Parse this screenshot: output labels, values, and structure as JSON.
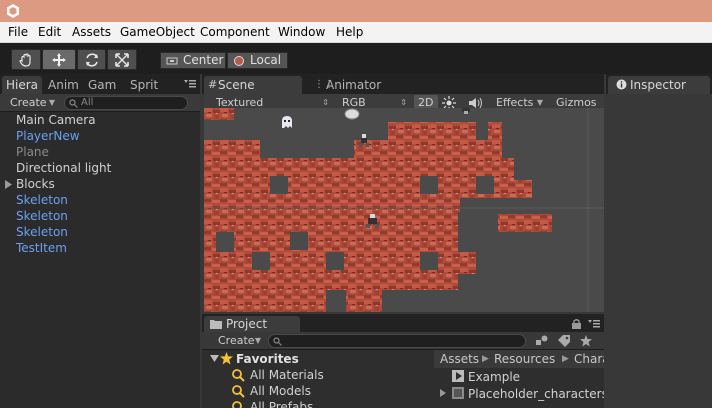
{
  "app": {
    "logo_icon": "unity-logo-icon"
  },
  "menu": {
    "items": [
      "File",
      "Edit",
      "Assets",
      "GameObject",
      "Component",
      "Window",
      "Help"
    ]
  },
  "toolbar": {
    "pivot": "Center",
    "space": "Local"
  },
  "hierarchy": {
    "tabs": [
      "Hiera",
      "Anim",
      "Gam",
      "Sprit"
    ],
    "create_label": "Create",
    "search_placeholder": "All",
    "items": [
      {
        "label": "Main Camera",
        "style": "normal"
      },
      {
        "label": "PlayerNew",
        "style": "blue"
      },
      {
        "label": "Plane",
        "style": "gray"
      },
      {
        "label": "Directional light",
        "style": "normal"
      },
      {
        "label": "Blocks",
        "style": "normal",
        "expandable": true
      },
      {
        "label": "Skeleton",
        "style": "blue"
      },
      {
        "label": "Skeleton",
        "style": "blue"
      },
      {
        "label": "Skeleton",
        "style": "blue"
      },
      {
        "label": "TestItem",
        "style": "blue"
      }
    ]
  },
  "scene": {
    "tabs": [
      "Scene",
      "Animator"
    ],
    "toolbar": {
      "render_mode": "Textured",
      "channel": "RGB",
      "mode_2d": "2D",
      "effects": "Effects",
      "gizmos": "Gizmos"
    }
  },
  "inspector": {
    "tab": "Inspector"
  },
  "project": {
    "tab": "Project",
    "create_label": "Create",
    "favorites_label": "Favorites",
    "favorites": [
      "All Materials",
      "All Models",
      "All Prefabs"
    ],
    "breadcrumb": [
      "Assets",
      "Resources",
      "Chara"
    ],
    "assets": [
      "Example",
      "Placeholder_charactersl"
    ]
  },
  "colors": {
    "title_bar": "#dc9a82",
    "brick": "#b04a3a",
    "prefab_blue": "#6aa0f0"
  }
}
